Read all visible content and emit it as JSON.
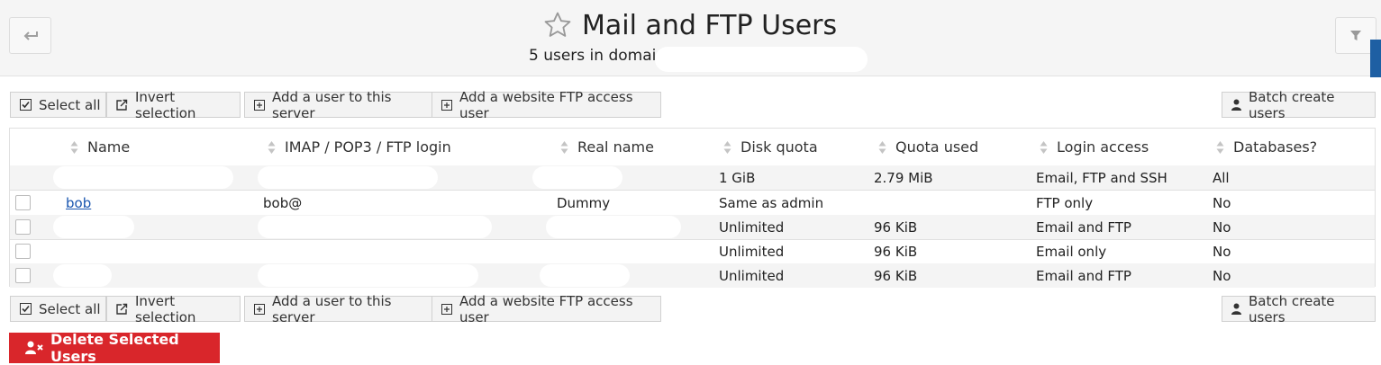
{
  "header": {
    "title": "Mail and FTP Users",
    "subtitle": "5 users in domain"
  },
  "toolbar": {
    "select_all": "Select all",
    "invert_selection": "Invert selection",
    "add_user": "Add a user to this server",
    "add_ftp_user": "Add a website FTP access user",
    "batch_create": "Batch create users"
  },
  "table": {
    "headers": {
      "name": "Name",
      "login": "IMAP / POP3 / FTP login",
      "real_name": "Real name",
      "disk_quota": "Disk quota",
      "quota_used": "Quota used",
      "login_access": "Login access",
      "databases": "Databases?"
    },
    "rows": [
      {
        "name": "",
        "login": "",
        "real_name": "",
        "disk_quota": "1 GiB",
        "quota_used": "2.79 MiB",
        "login_access": "Email, FTP and SSH",
        "databases": "All"
      },
      {
        "name": "bob",
        "login": "bob@",
        "real_name": "Dummy",
        "disk_quota": "Same as admin",
        "quota_used": "",
        "login_access": "FTP only",
        "databases": "No"
      },
      {
        "name": "",
        "login": "",
        "real_name": "",
        "disk_quota": "Unlimited",
        "quota_used": "96 KiB",
        "login_access": "Email and FTP",
        "databases": "No"
      },
      {
        "name": "",
        "login": "",
        "real_name": "",
        "disk_quota": "Unlimited",
        "quota_used": "96 KiB",
        "login_access": "Email only",
        "databases": "No"
      },
      {
        "name": "",
        "login": "",
        "real_name": "",
        "disk_quota": "Unlimited",
        "quota_used": "96 KiB",
        "login_access": "Email and FTP",
        "databases": "No"
      }
    ]
  },
  "actions": {
    "delete_selected": "Delete Selected Users"
  }
}
